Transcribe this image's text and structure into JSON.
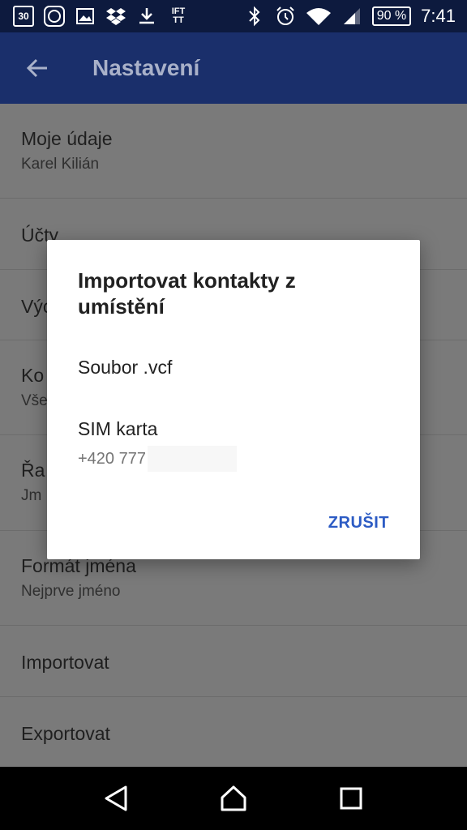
{
  "status_bar": {
    "calendar_day": "30",
    "ifttt": "IFT TT",
    "battery": "90 %",
    "time": "7:41"
  },
  "app_bar": {
    "title": "Nastavení"
  },
  "settings": {
    "items": [
      {
        "title": "Moje údaje",
        "subtitle": "Karel Kilián"
      },
      {
        "title": "Účty",
        "subtitle": ""
      },
      {
        "title": "Výc",
        "subtitle": ""
      },
      {
        "title": "Ko",
        "subtitle": "Vše"
      },
      {
        "title": "Řa",
        "subtitle": "Jm"
      },
      {
        "title": "Formát jména",
        "subtitle": "Nejprve jméno"
      },
      {
        "title": "Importovat",
        "subtitle": ""
      },
      {
        "title": "Exportovat",
        "subtitle": ""
      }
    ]
  },
  "dialog": {
    "title": "Importovat kontakty z umístění",
    "option_file": "Soubor .vcf",
    "option_sim": "SIM karta",
    "sim_number": "+420 777",
    "cancel_label": "ZRUŠIT"
  }
}
